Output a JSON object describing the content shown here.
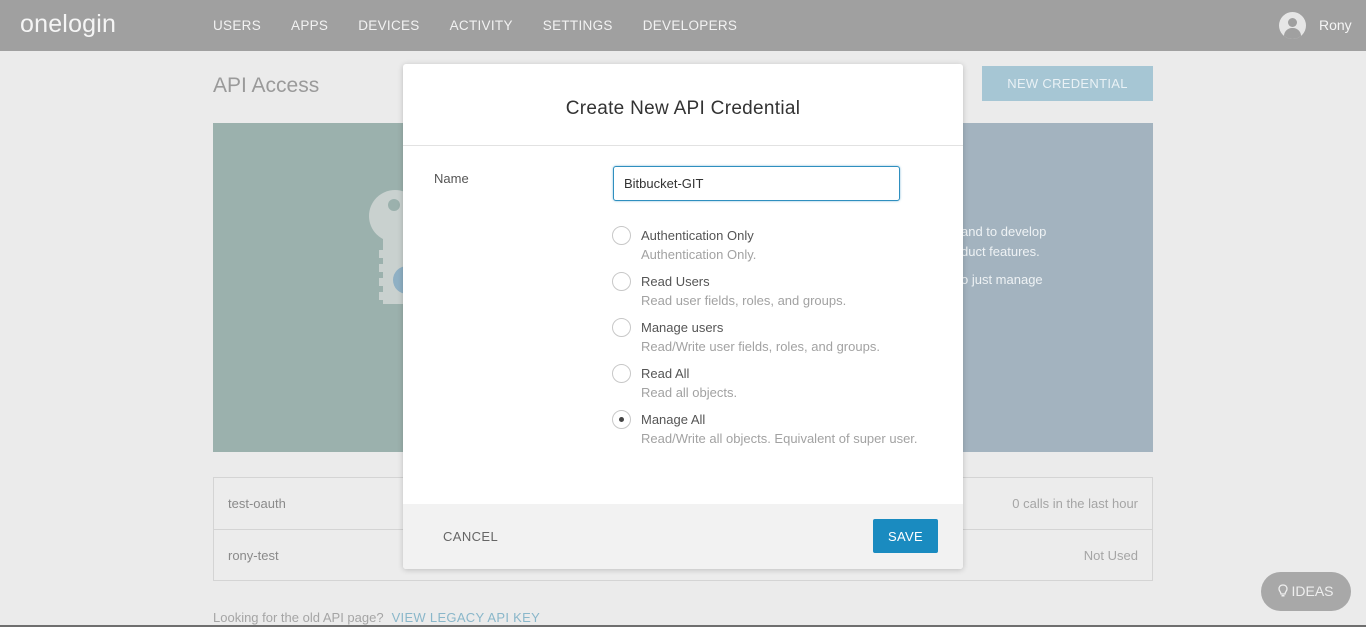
{
  "header": {
    "logo": "onelogin",
    "nav": [
      "USERS",
      "APPS",
      "DEVICES",
      "ACTIVITY",
      "SETTINGS",
      "DEVELOPERS"
    ],
    "username": "Rony"
  },
  "page": {
    "title": "API Access",
    "new_credential_label": "NEW CREDENTIAL",
    "hero_lines": [
      "and to develop",
      "duct features.",
      "o just manage"
    ],
    "credentials": [
      {
        "name": "test-oauth",
        "status": "0 calls in the last hour"
      },
      {
        "name": "rony-test",
        "status": "Not Used"
      }
    ],
    "footer_text": "Looking for the old API page?",
    "footer_link": "VIEW LEGACY API KEY",
    "ideas_label": "IDEAS"
  },
  "modal": {
    "title": "Create New API Credential",
    "name_label": "Name",
    "name_value": "Bitbucket-GIT",
    "options": [
      {
        "label": "Authentication Only",
        "desc": "Authentication Only.",
        "checked": false
      },
      {
        "label": "Read Users",
        "desc": "Read user fields, roles, and groups.",
        "checked": false
      },
      {
        "label": "Manage users",
        "desc": "Read/Write user fields, roles, and groups.",
        "checked": false
      },
      {
        "label": "Read All",
        "desc": "Read all objects.",
        "checked": false
      },
      {
        "label": "Manage All",
        "desc": "Read/Write all objects. Equivalent of super user.",
        "checked": true
      }
    ],
    "cancel_label": "CANCEL",
    "save_label": "SAVE"
  },
  "colors": {
    "accent": "#1a8bc0",
    "topbar": "#a0a0a0",
    "overlay_bg": "#ebebeb"
  }
}
